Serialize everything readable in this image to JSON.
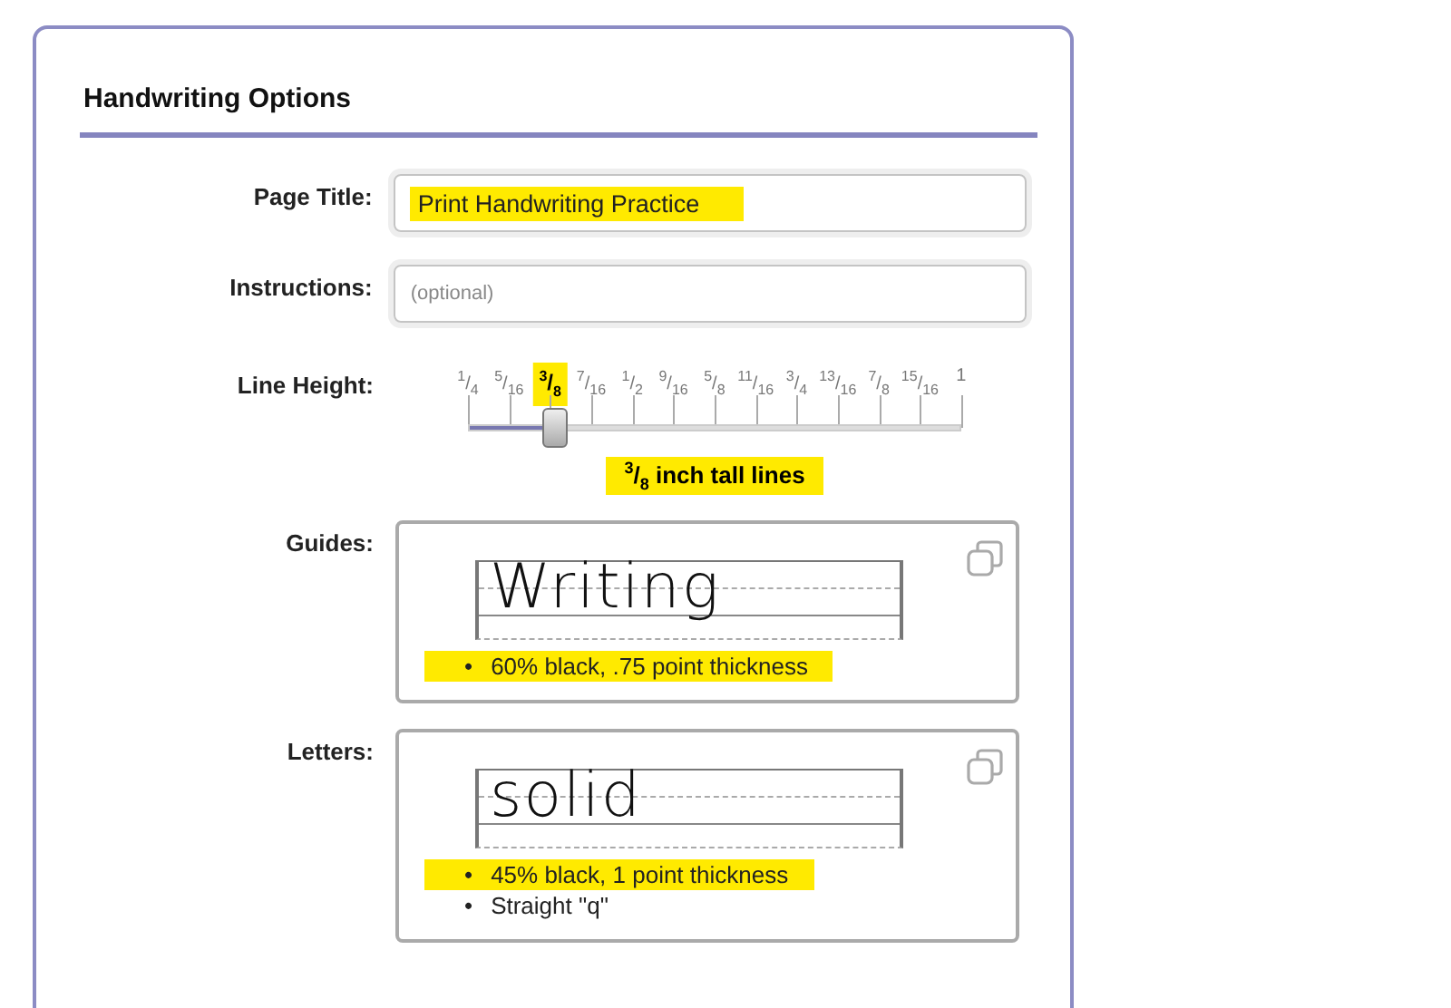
{
  "section": {
    "title": "Handwriting Options"
  },
  "fields": [
    {
      "label": "Page Title:",
      "value": "Print Handwriting Practice",
      "highlighted": true
    },
    {
      "label": "Instructions:",
      "placeholder": "(optional)",
      "highlighted": false
    }
  ],
  "line_height": {
    "label": "Line Height:",
    "ticks": [
      {
        "label": "$^{1}$/$_{4}$",
        "selected": false
      },
      {
        "label": "$^{5}$/$_{16}$",
        "selected": false
      },
      {
        "label": "$^{3}$/$_{8}$",
        "selected": true
      },
      {
        "label": "$^{7}$/$_{16}$",
        "selected": false
      },
      {
        "label": "$^{1}$/$_{2}$",
        "selected": false
      },
      {
        "label": "$^{9}$/$_{16}$",
        "selected": false
      },
      {
        "label": "$^{5}$/$_{8}$",
        "selected": false
      },
      {
        "label": "$^{11}$/$_{16}$",
        "selected": false
      },
      {
        "label": "$^{3}$/$_{4}$",
        "selected": false
      },
      {
        "label": "$^{13}$/$_{16}$",
        "selected": false
      },
      {
        "label": "$^{7}$/$_{8}$",
        "selected": false
      },
      {
        "label": "$^{15}$/$_{16}$",
        "selected": false
      },
      {
        "label": "1",
        "selected": false
      }
    ],
    "level": 0.1667,
    "reading": "$^{3}$/$_{8}$ inch tall lines",
    "reading_highlighted": true
  },
  "styles": [
    {
      "label": "Guides:",
      "sample": "Writing",
      "notes": [
        {
          "marker": "•",
          "text": "60% black, .75 point thickness",
          "highlighted": true
        }
      ]
    },
    {
      "label": "Letters:",
      "sample": "solid",
      "notes": [
        {
          "marker": "•",
          "text": "45% black, 1 point thickness",
          "highlighted": true
        },
        {
          "marker": "•",
          "text": "Straight \"q\"",
          "highlighted": false
        }
      ]
    }
  ]
}
